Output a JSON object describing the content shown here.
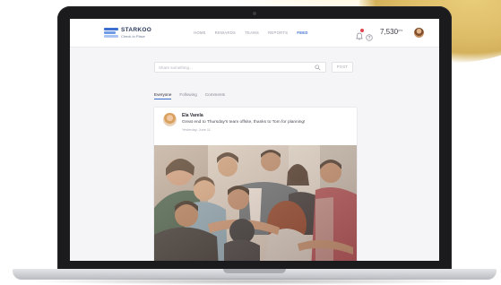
{
  "colors": {
    "accent": "#3d6fd1",
    "notification": "#e0454f",
    "screen_bg": "#f5f4f6"
  },
  "logo": {
    "name": "STARKOO",
    "tagline": "Check In Place"
  },
  "nav": {
    "items": [
      {
        "label": "HOME",
        "active": false
      },
      {
        "label": "REWARDS",
        "active": false
      },
      {
        "label": "TEAMS",
        "active": false
      },
      {
        "label": "REPORTS",
        "active": false
      },
      {
        "label": "FEED",
        "active": true
      }
    ]
  },
  "header": {
    "points": "7,530",
    "points_unit": "pts",
    "icons": [
      "bell-icon",
      "help-icon"
    ]
  },
  "search": {
    "placeholder": "Share something...",
    "button_label": "POST"
  },
  "tabs": [
    {
      "label": "Everyone",
      "active": true
    },
    {
      "label": "Following",
      "active": false
    },
    {
      "label": "Comments",
      "active": false
    }
  ],
  "post": {
    "author": "Ela Varela",
    "text": "Great end to Thursday's team offsite, thanks to Tom for planning!",
    "time": "Yesterday, June 11"
  }
}
